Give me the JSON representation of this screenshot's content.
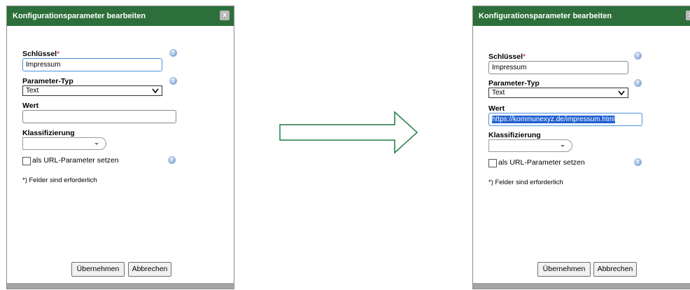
{
  "dialog_title": "Konfigurationsparameter bearbeiten",
  "close_label": "x",
  "fields": {
    "key_label": "Schlüssel",
    "required_mark": "*",
    "type_label": "Parameter-Typ",
    "value_label": "Wert",
    "classification_label": "Klassifizierung",
    "url_param_label": "als URL-Parameter setzen"
  },
  "note": "*) Felder sind erforderlich",
  "buttons": {
    "apply": "Übernehmen",
    "cancel": "Abbrechen"
  },
  "help_glyph": "?",
  "before": {
    "key_value": "Impressum",
    "type_value": "Text",
    "value_value": "",
    "classification_value": "",
    "url_param_checked": false
  },
  "after": {
    "key_value": "Impressum",
    "type_value": "Text",
    "value_value": "https://kommunexyz.de/impressum.html",
    "classification_value": "",
    "url_param_checked": false
  },
  "colors": {
    "titlebar": "#2c6f3a",
    "arrow": "#1e7a45",
    "footer": "#a5a5a5",
    "focus": "#4a90d9",
    "selection": "#1f5fd0"
  },
  "icons": [
    "close-icon",
    "help-icon",
    "chevron-down-icon",
    "checkbox-icon",
    "right-arrow-icon"
  ]
}
